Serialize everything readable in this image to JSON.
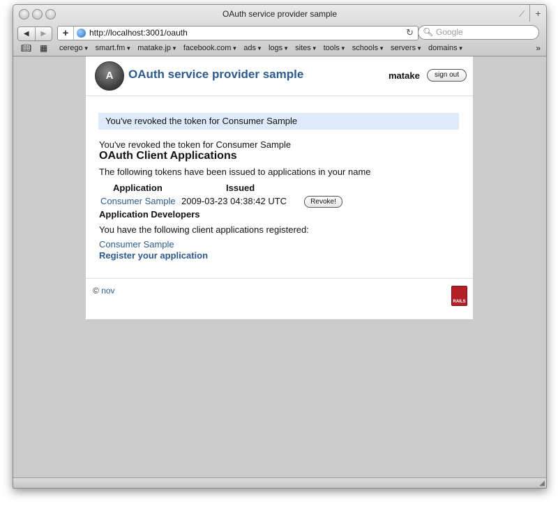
{
  "window": {
    "title": "OAuth service provider sample"
  },
  "toolbar": {
    "back_icon": "back-arrow-icon",
    "forward_icon": "forward-arrow-icon",
    "url": "http://localhost:3001/oauth",
    "search_placeholder": "Google"
  },
  "bookmarks": {
    "items": [
      "cerego",
      "smart.fm",
      "matake.jp",
      "facebook.com",
      "ads",
      "logs",
      "sites",
      "tools",
      "schools",
      "servers",
      "domains"
    ],
    "more": "»"
  },
  "page": {
    "site_title": "OAuth service provider sample",
    "username": "matake",
    "signout_label": "sign out",
    "flash": "You've revoked the token for Consumer Sample",
    "notice": "You've revoked the token for Consumer Sample",
    "heading": "OAuth Client Applications",
    "tokens_intro": "The following tokens have been issued to applications in your name",
    "table": {
      "headers": [
        "Application",
        "Issued"
      ],
      "rows": [
        {
          "application": "Consumer Sample",
          "issued": "2009-03-23 04:38:42 UTC",
          "action": "Revoke!"
        }
      ]
    },
    "developers_heading": "Application Developers",
    "developers_intro": "You have the following client applications registered:",
    "registered_app": "Consumer Sample",
    "register_link": "Register your application",
    "footer": {
      "copyright_symbol": "©",
      "author": "nov"
    }
  },
  "colors": {
    "link": "#2d5a8c",
    "flash_bg": "#dceafb",
    "viewport_bg": "#cbcbcb"
  }
}
